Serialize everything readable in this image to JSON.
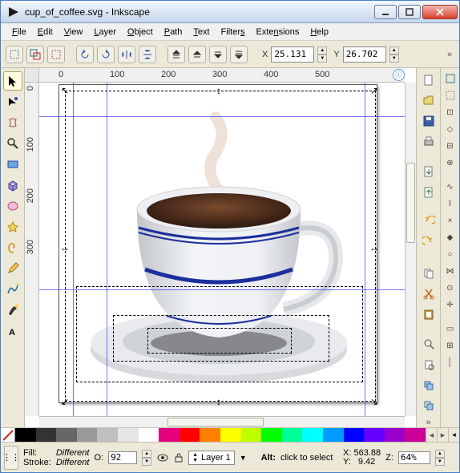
{
  "title": "cup_of_coffee.svg - Inkscape",
  "menu": [
    "File",
    "Edit",
    "View",
    "Layer",
    "Object",
    "Path",
    "Text",
    "Filters",
    "Extensions",
    "Help"
  ],
  "toolbar": {
    "x_label": "X",
    "y_label": "Y",
    "x": "25.131",
    "y": "26.702"
  },
  "ruler": {
    "hticks": [
      "0",
      "100",
      "200",
      "300",
      "400",
      "500"
    ],
    "vticks": [
      "0",
      "100",
      "200",
      "300"
    ]
  },
  "palette": [
    "#000000",
    "#333333",
    "#666666",
    "#999999",
    "#bfbfbf",
    "#e6e6e6",
    "#ffffff",
    "#e6007e",
    "#ff0000",
    "#ff7f00",
    "#ffff00",
    "#c0ff00",
    "#00ff00",
    "#00ff99",
    "#00ffff",
    "#009bff",
    "#0000ff",
    "#6300ff",
    "#9900cc",
    "#cc0099"
  ],
  "status": {
    "fill_label": "Fill:",
    "stroke_label": "Stroke:",
    "fill_value": "Different",
    "stroke_value": "Different",
    "opacity_label": "O:",
    "opacity_value": "92",
    "layer": "Layer 1",
    "hint_label": "Alt:",
    "hint": "click to select",
    "cursor_xlabel": "X:",
    "cursor_ylabel": "Y:",
    "cursor_x": "563.88",
    "cursor_y": "9.42",
    "zoom_label": "Z:",
    "zoom_value": "64%"
  },
  "icons": {
    "pointer": "pointer",
    "node": "node",
    "tweak": "tweak",
    "zoom": "zoom",
    "rect": "rect",
    "box3d": "box3d",
    "ellipse": "ellipse",
    "star": "star",
    "spiral": "spiral",
    "pencil": "pencil",
    "bezier": "bezier",
    "calli": "calligraphy",
    "text": "text"
  }
}
